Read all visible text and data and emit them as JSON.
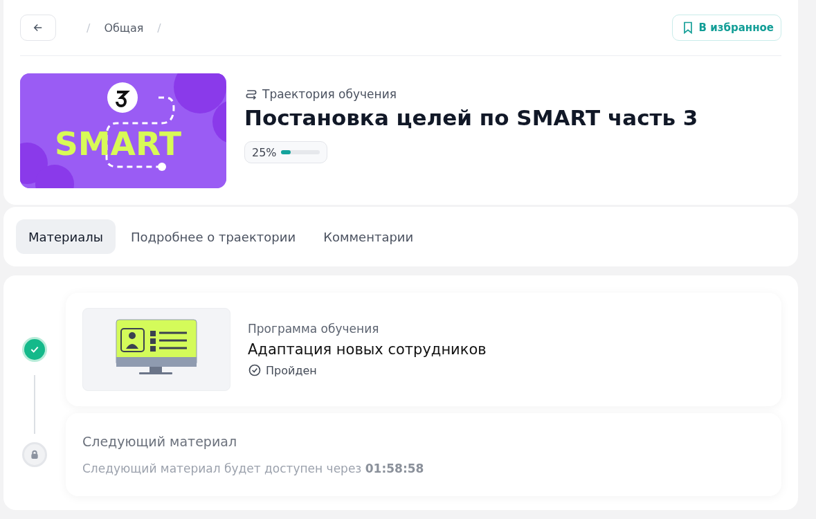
{
  "breadcrumbs": [
    {
      "kind": "separator",
      "text": "/"
    },
    {
      "kind": "link",
      "text": "Общая"
    },
    {
      "kind": "separator",
      "text": "/"
    }
  ],
  "favorite_button": {
    "label": "В избранное"
  },
  "cover": {
    "text": "SMART"
  },
  "type_label": "Траектория обучения",
  "title": "Постановка целей по SMART часть 3",
  "progress": {
    "reading": "25%",
    "level": 0.25
  },
  "tabs": [
    {
      "label": "Материалы",
      "selected": true
    },
    {
      "label": "Подробнее о траектории",
      "selected": false
    },
    {
      "label": "Комментарии",
      "selected": false
    }
  ],
  "materials": [
    {
      "kind": "completed",
      "type": "Программа обучения",
      "title": "Адаптация новых сотрудников",
      "status": "Пройден"
    },
    {
      "kind": "locked",
      "title": "Следующий материал",
      "note": "Следующий материал будет доступен через **01:58:58**"
    }
  ]
}
